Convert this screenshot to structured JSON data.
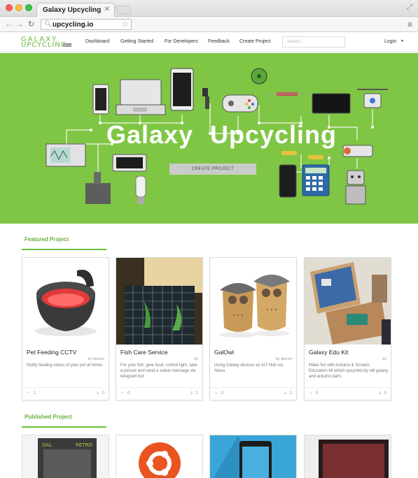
{
  "browser": {
    "tab_title": "Galaxy Upcycling",
    "tab_close": "✕",
    "url": "upcycling.io"
  },
  "site": {
    "logo_line1": "GALAXY",
    "logo_line2": "UPCYCLING",
    "logo_badge": "BETA",
    "nav": [
      "Dashboard",
      "Getting Started",
      "For Developers",
      "Feedback",
      "Create Project"
    ],
    "search_placeholder": "Search...",
    "login": "Login"
  },
  "hero": {
    "title_word1": "Galaxy",
    "title_word2": "Upcycling",
    "button": "CREATE PROJECT",
    "background": "#80c645"
  },
  "featured": {
    "heading": "Featured Project",
    "cards": [
      {
        "title": "Pet Feeding CCTV",
        "author": "by darren",
        "description": "Notify feeding status of your pet at home.",
        "likes": "1",
        "downloads": "0"
      },
      {
        "title": "Fish Care Service",
        "author": "by",
        "description": "For your fish, give food, control light, take a picture and send a status message via telegram bot",
        "likes": "0",
        "downloads": "1"
      },
      {
        "title": "GalOwl",
        "author": "by darren",
        "description": "Using Galaxy devices as IoT Hub via Alexa",
        "likes": "0",
        "downloads": "1"
      },
      {
        "title": "Galaxy Edu Kit",
        "author": "by",
        "description": "Make fun with Arduino & Scratch Education kit which upcycled by old galaxy and arduino parts",
        "likes": "0",
        "downloads": "0"
      }
    ]
  },
  "published": {
    "heading": "Published Project"
  },
  "colors": {
    "accent": "#6cbf3a",
    "hero_bg": "#80c645"
  }
}
